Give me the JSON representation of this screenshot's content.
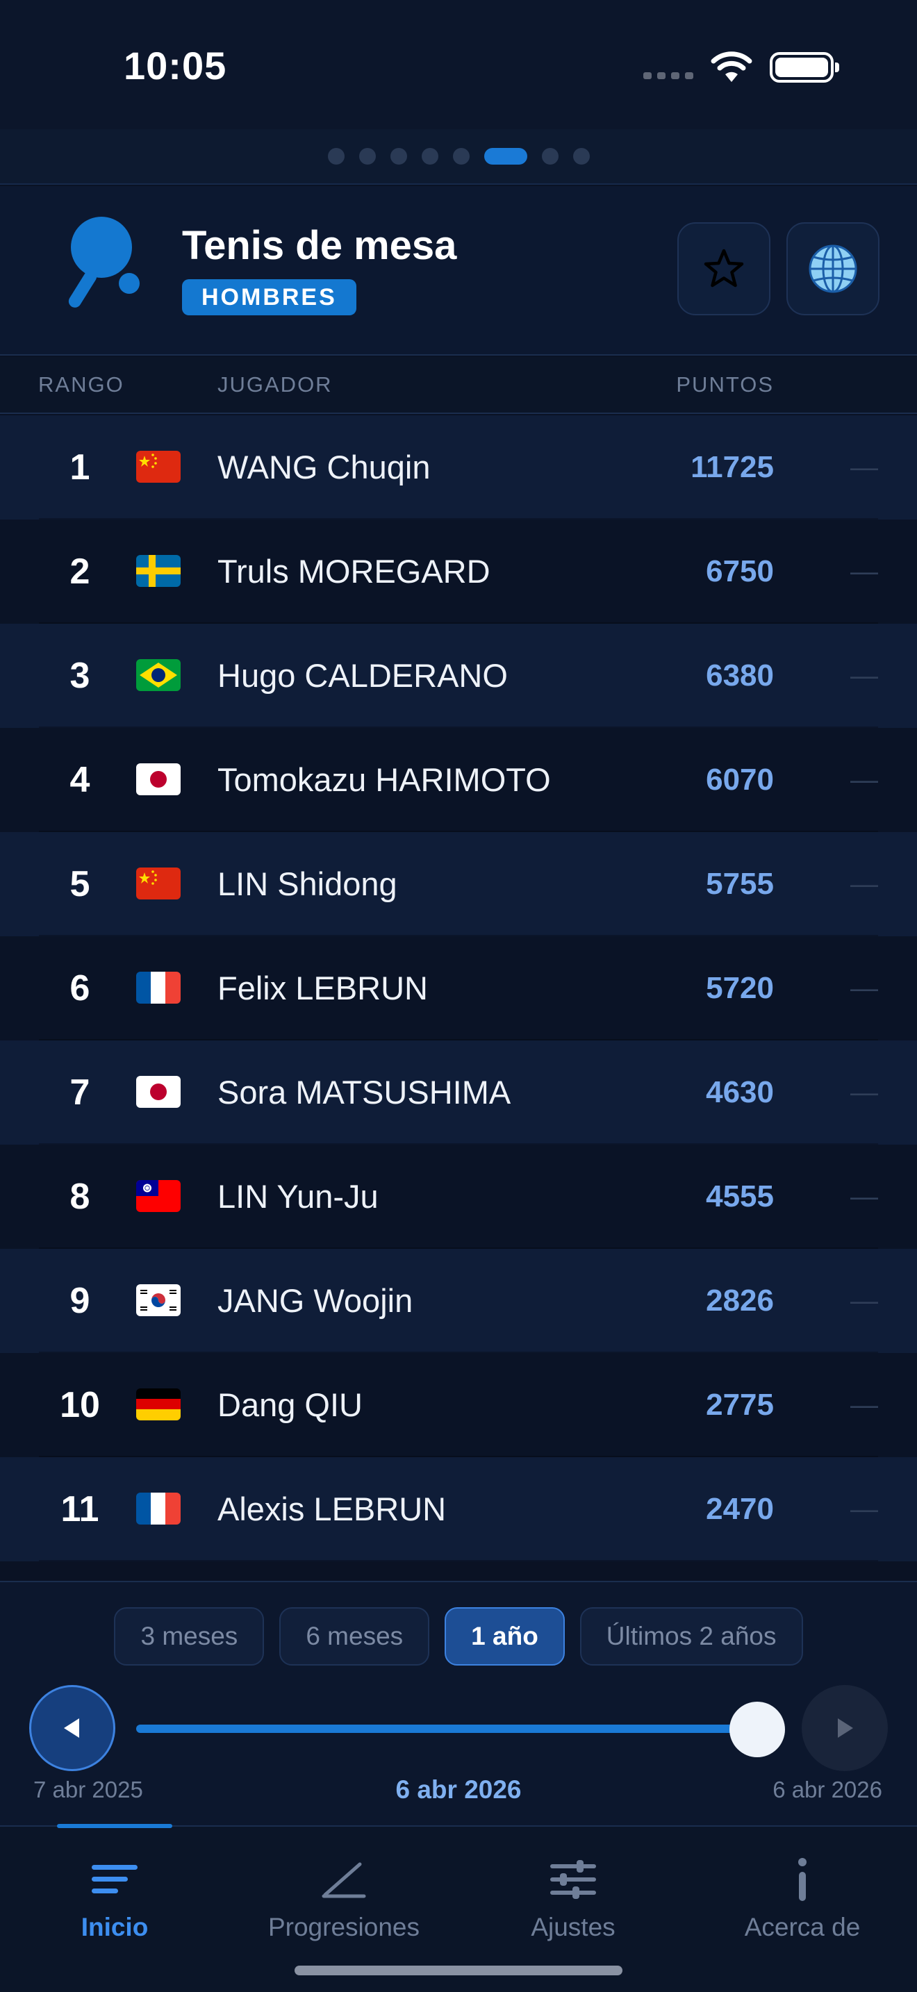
{
  "status_bar": {
    "time": "10:05"
  },
  "page_indicator": {
    "count": 8,
    "active_index": 5
  },
  "header": {
    "sport_title": "Tenis de mesa",
    "gender_badge": "HOMBRES",
    "paddle_color": "#1478d0"
  },
  "table": {
    "columns": {
      "rank": "RANGO",
      "player": "JUGADOR",
      "points": "PUNTOS"
    },
    "rows": [
      {
        "rank": "1",
        "flag": "china",
        "name": "WANG Chuqin",
        "points": "11725",
        "change": "—"
      },
      {
        "rank": "2",
        "flag": "sweden",
        "name": "Truls MOREGARD",
        "points": "6750",
        "change": "—"
      },
      {
        "rank": "3",
        "flag": "brazil",
        "name": "Hugo CALDERANO",
        "points": "6380",
        "change": "—"
      },
      {
        "rank": "4",
        "flag": "japan",
        "name": "Tomokazu HARIMOTO",
        "points": "6070",
        "change": "—"
      },
      {
        "rank": "5",
        "flag": "china",
        "name": "LIN Shidong",
        "points": "5755",
        "change": "—"
      },
      {
        "rank": "6",
        "flag": "france",
        "name": "Felix LEBRUN",
        "points": "5720",
        "change": "—"
      },
      {
        "rank": "7",
        "flag": "japan",
        "name": "Sora MATSUSHIMA",
        "points": "4630",
        "change": "—"
      },
      {
        "rank": "8",
        "flag": "taiwan",
        "name": "LIN Yun-Ju",
        "points": "4555",
        "change": "—"
      },
      {
        "rank": "9",
        "flag": "korea",
        "name": "JANG Woojin",
        "points": "2826",
        "change": "—"
      },
      {
        "rank": "10",
        "flag": "germany",
        "name": "Dang QIU",
        "points": "2775",
        "change": "—"
      },
      {
        "rank": "11",
        "flag": "france",
        "name": "Alexis LEBRUN",
        "points": "2470",
        "change": "—"
      }
    ]
  },
  "time_range": {
    "options": [
      "3 meses",
      "6 meses",
      "1 año",
      "Últimos 2 años"
    ],
    "selected": "1 año",
    "start_date": "7 abr 2025",
    "current_date": "6 abr 2026",
    "end_date": "6 abr 2026",
    "slider_position": 1.0
  },
  "tabs": [
    {
      "label": "Inicio",
      "icon": "list-icon",
      "active": true
    },
    {
      "label": "Progresiones",
      "icon": "trend-line-icon",
      "active": false
    },
    {
      "label": "Ajustes",
      "icon": "sliders-icon",
      "active": false
    },
    {
      "label": "Acerca de",
      "icon": "info-icon",
      "active": false
    }
  ],
  "colors": {
    "accent": "#1a7ad6",
    "points_text": "#78a8ec",
    "background": "#0a1224"
  }
}
